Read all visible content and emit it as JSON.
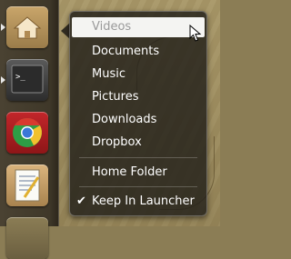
{
  "launcher": {
    "icons": [
      {
        "name": "home-folder-icon",
        "active": true
      },
      {
        "name": "terminal-icon",
        "active": true
      },
      {
        "name": "chrome-icon",
        "active": false
      },
      {
        "name": "text-editor-icon",
        "active": false
      },
      {
        "name": "app-icon-partial",
        "active": false
      }
    ]
  },
  "quicklist": {
    "bookmarks": [
      {
        "label": "Videos"
      },
      {
        "label": "Documents"
      },
      {
        "label": "Music"
      },
      {
        "label": "Pictures"
      },
      {
        "label": "Downloads"
      },
      {
        "label": "Dropbox"
      }
    ],
    "home_folder_label": "Home Folder",
    "keep_in_launcher_label": "Keep In Launcher",
    "keep_in_launcher_checked": true,
    "check_glyph": "✔"
  },
  "colors": {
    "highlight_bg": "#f4f4f2",
    "highlight_text": "#9a9a9a",
    "menu_bg": "#22201a",
    "menu_text": "#ffffff"
  }
}
